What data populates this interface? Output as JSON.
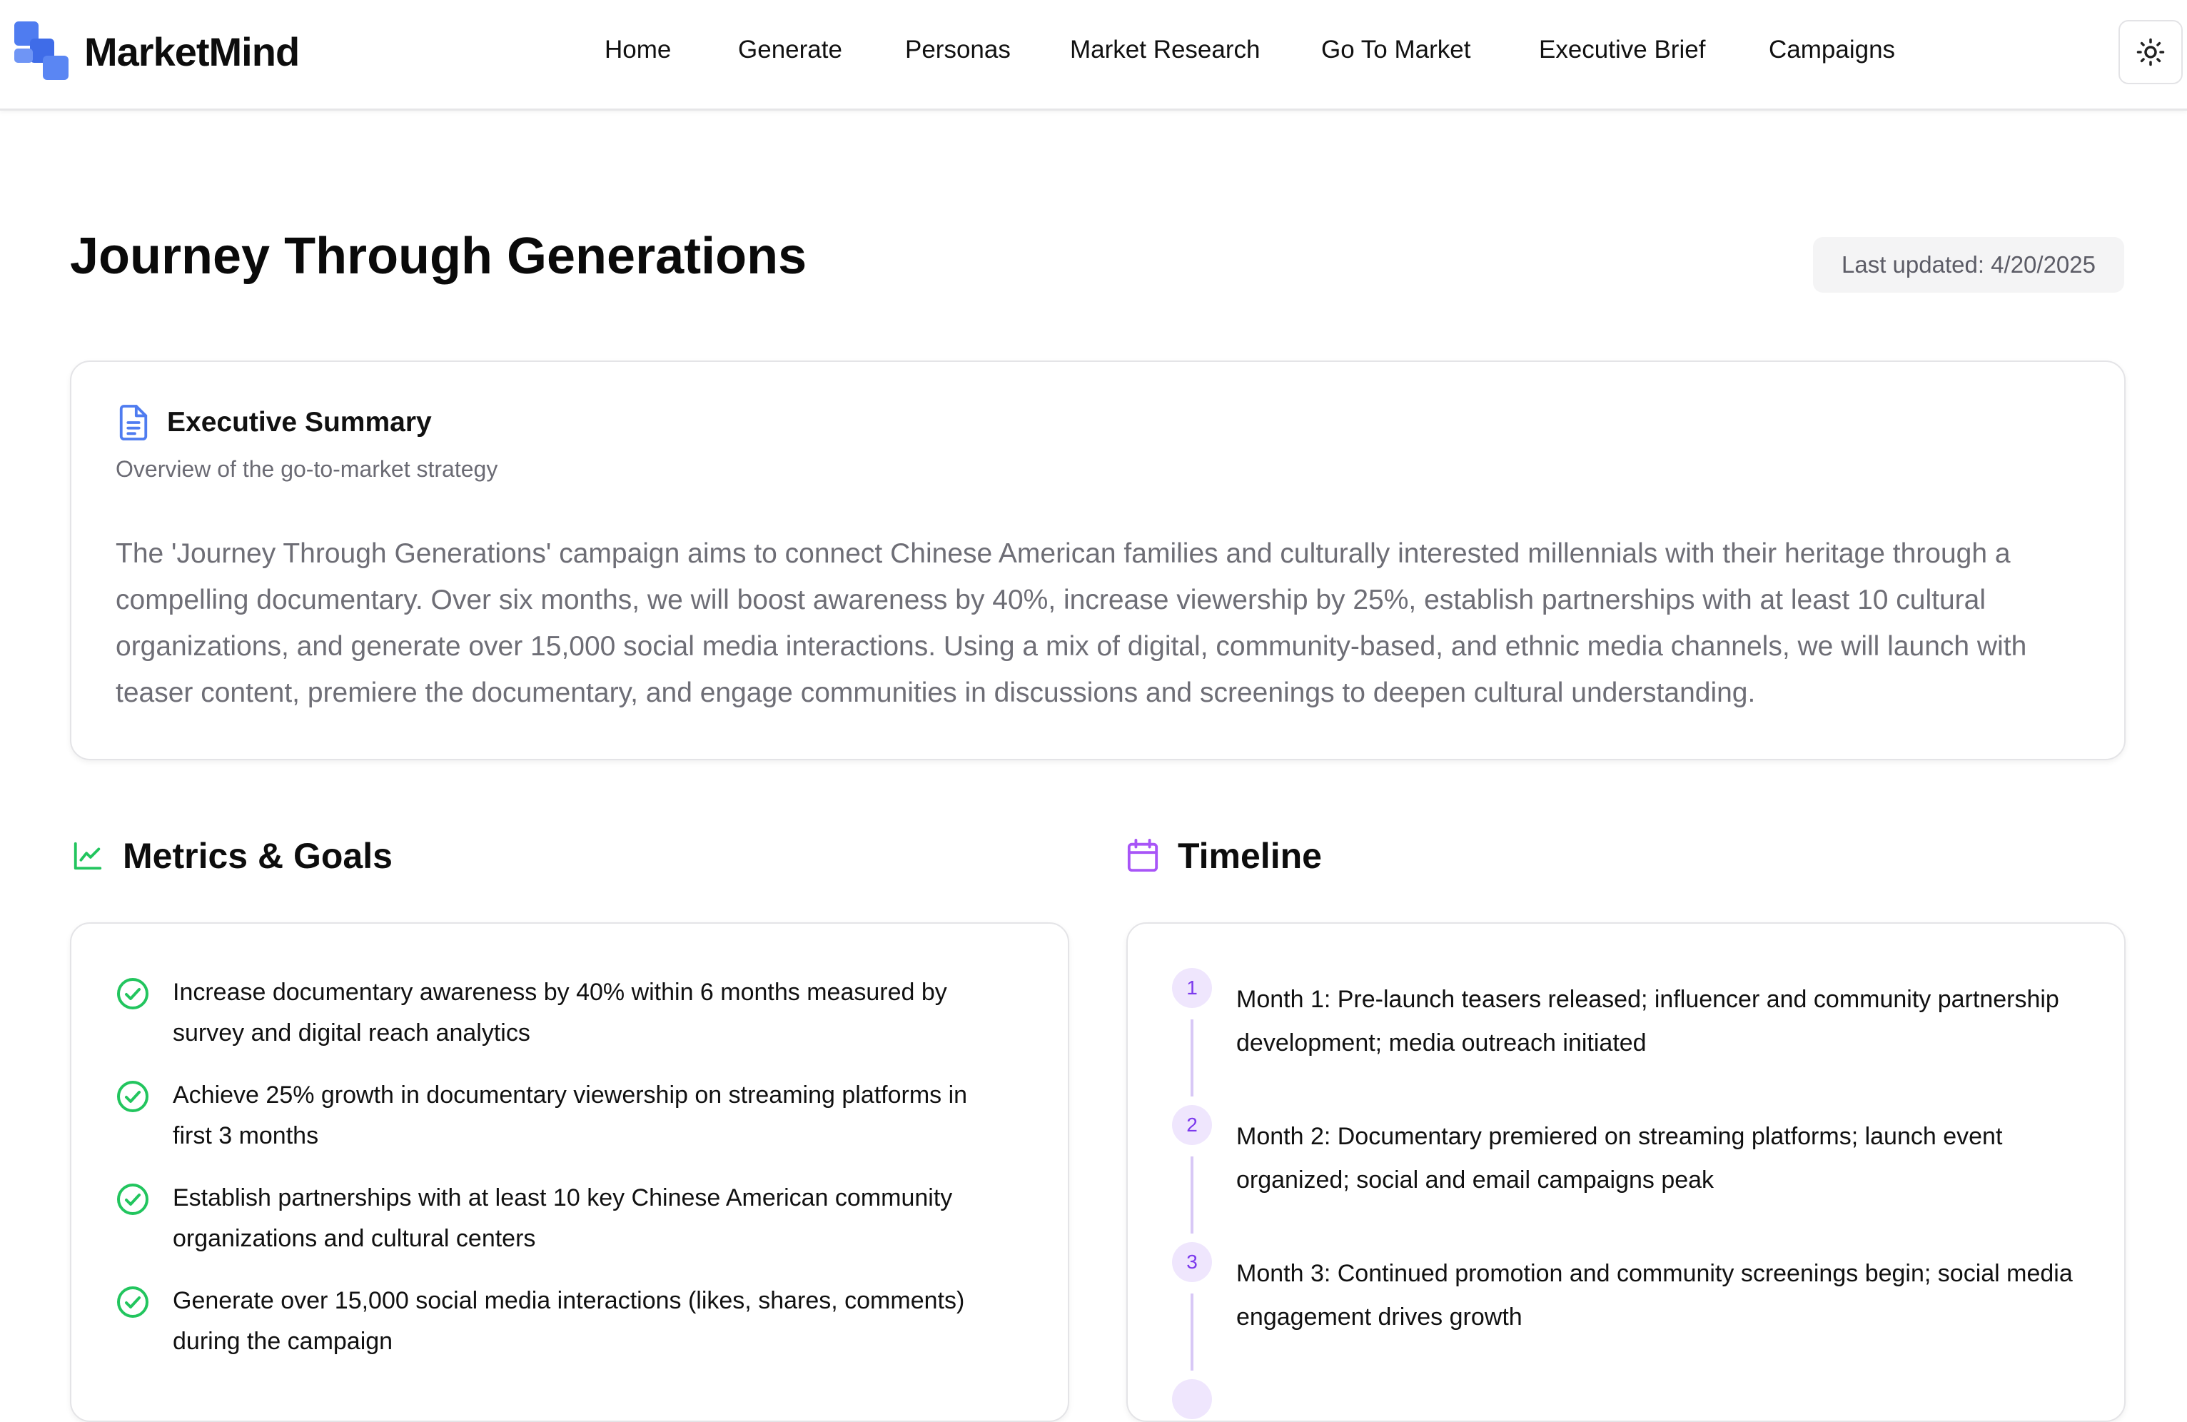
{
  "app": {
    "name": "MarketMind",
    "logo_icon": "grid-blocks-icon",
    "brand_color": "#4f7cf0"
  },
  "nav": {
    "items": [
      {
        "label": "Home"
      },
      {
        "label": "Generate"
      },
      {
        "label": "Personas"
      },
      {
        "label": "Market Research"
      },
      {
        "label": "Go To Market"
      },
      {
        "label": "Executive Brief"
      },
      {
        "label": "Campaigns"
      }
    ],
    "theme_toggle_icon": "sun-icon"
  },
  "page": {
    "title": "Journey Through Generations",
    "last_updated": "Last updated: 4/20/2025"
  },
  "summary": {
    "icon": "document-icon",
    "title": "Executive Summary",
    "subtitle": "Overview of the go-to-market strategy",
    "body": "The 'Journey Through Generations' campaign aims to connect Chinese American families and culturally interested millennials with their heritage through a compelling documentary. Over six months, we will boost awareness by 40%, increase viewership by 25%, establish partnerships with at least 10 cultural organizations, and generate over 15,000 social media interactions. Using a mix of digital, community-based, and ethnic media channels, we will launch with teaser content, premiere the documentary, and engage communities in discussions and screenings to deepen cultural understanding."
  },
  "metrics": {
    "icon": "line-chart-icon",
    "title": "Metrics & Goals",
    "accent_color": "#22c55e",
    "goals": [
      "Increase documentary awareness by 40% within 6 months measured by survey and digital reach analytics",
      "Achieve 25% growth in documentary viewership on streaming platforms in first 3 months",
      "Establish partnerships with at least 10 key Chinese American community organizations and cultural centers",
      "Generate over 15,000 social media interactions (likes, shares, comments) during the campaign"
    ]
  },
  "timeline": {
    "icon": "calendar-icon",
    "title": "Timeline",
    "accent_color": "#7c3aed",
    "steps": [
      {
        "number": "1",
        "text": "Month 1: Pre-launch teasers released; influencer and community partnership development; media outreach initiated"
      },
      {
        "number": "2",
        "text": "Month 2: Documentary premiered on streaming platforms; launch event organized; social and email campaigns peak"
      },
      {
        "number": "3",
        "text": "Month 3: Continued promotion and community screenings begin; social media engagement drives growth"
      }
    ]
  }
}
